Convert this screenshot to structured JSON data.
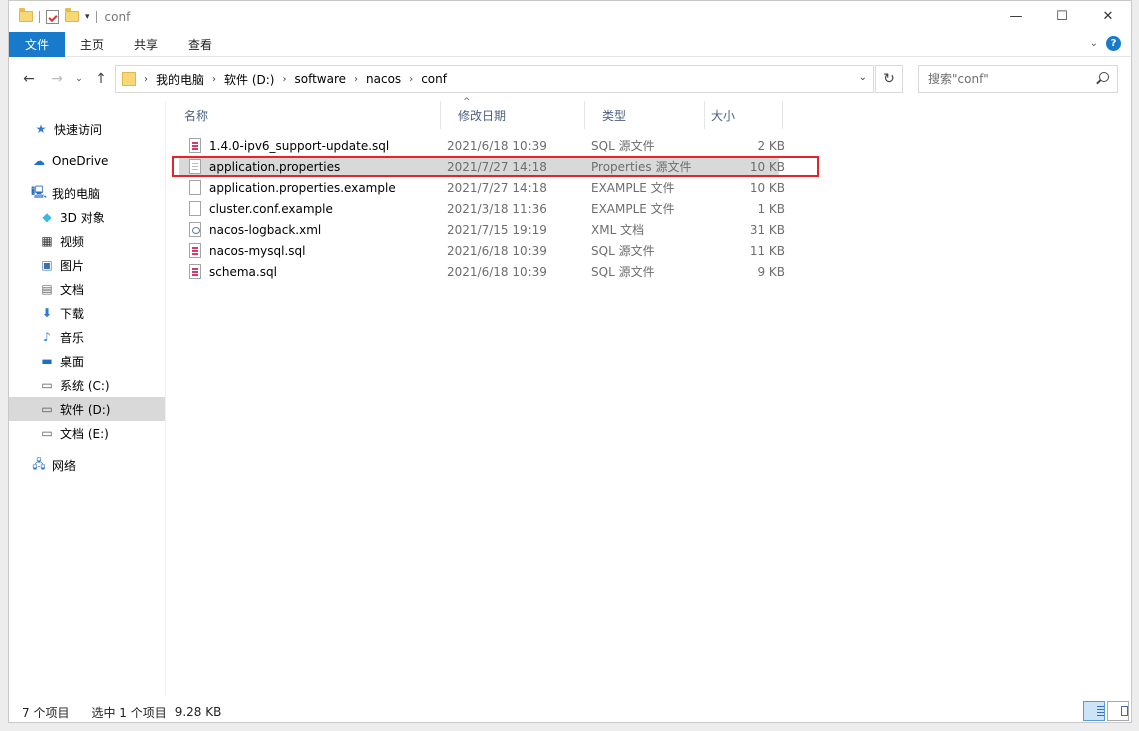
{
  "window": {
    "title": "conf",
    "controls": [
      "—",
      "☐",
      "✕"
    ]
  },
  "ribbon": {
    "tabs": [
      {
        "label": "文件",
        "active": true
      },
      {
        "label": "主页"
      },
      {
        "label": "共享"
      },
      {
        "label": "查看"
      }
    ],
    "accent_color": "#1979ca"
  },
  "address": {
    "crumbs": [
      "我的电脑",
      "软件 (D:)",
      "software",
      "nacos",
      "conf"
    ]
  },
  "search": {
    "placeholder": "搜索\"conf\""
  },
  "navpane": {
    "items": [
      {
        "label": "快速访问",
        "icon": "star-icon"
      },
      {
        "label": "OneDrive",
        "icon": "cloud-icon"
      },
      {
        "label": "我的电脑",
        "icon": "computer-icon"
      },
      {
        "label": "3D 对象",
        "icon": "cube-icon"
      },
      {
        "label": "视频",
        "icon": "film-icon"
      },
      {
        "label": "图片",
        "icon": "picture-icon"
      },
      {
        "label": "文档",
        "icon": "document-icon"
      },
      {
        "label": "下载",
        "icon": "download-arrow-icon"
      },
      {
        "label": "音乐",
        "icon": "music-note-icon"
      },
      {
        "label": "桌面",
        "icon": "desktop-icon"
      },
      {
        "label": "系统 (C:)",
        "icon": "drive-icon"
      },
      {
        "label": "软件 (D:)",
        "icon": "drive-icon",
        "selected": true
      },
      {
        "label": "文档 (E:)",
        "icon": "drive-icon"
      },
      {
        "label": "网络",
        "icon": "network-icon"
      }
    ]
  },
  "columns": {
    "name": "名称",
    "date": "修改日期",
    "type": "类型",
    "size": "大小"
  },
  "files": [
    {
      "name": "1.4.0-ipv6_support-update.sql",
      "date": "2021/6/18 10:39",
      "type": "SQL 源文件",
      "size": "2 KB",
      "icon": "sql"
    },
    {
      "name": "application.properties",
      "date": "2021/7/27 14:18",
      "type": "Properties 源文件",
      "size": "10 KB",
      "icon": "props",
      "selected": true
    },
    {
      "name": "application.properties.example",
      "date": "2021/7/27 14:18",
      "type": "EXAMPLE 文件",
      "size": "10 KB",
      "icon": "blank"
    },
    {
      "name": "cluster.conf.example",
      "date": "2021/3/18 11:36",
      "type": "EXAMPLE 文件",
      "size": "1 KB",
      "icon": "blank"
    },
    {
      "name": "nacos-logback.xml",
      "date": "2021/7/15 19:19",
      "type": "XML 文档",
      "size": "31 KB",
      "icon": "xml"
    },
    {
      "name": "nacos-mysql.sql",
      "date": "2021/6/18 10:39",
      "type": "SQL 源文件",
      "size": "11 KB",
      "icon": "sql"
    },
    {
      "name": "schema.sql",
      "date": "2021/6/18 10:39",
      "type": "SQL 源文件",
      "size": "9 KB",
      "icon": "sql"
    }
  ],
  "highlight_color": "#e0262b",
  "status": {
    "count": "7 个项目",
    "selected": "选中 1 个项目",
    "size": "9.28 KB"
  }
}
